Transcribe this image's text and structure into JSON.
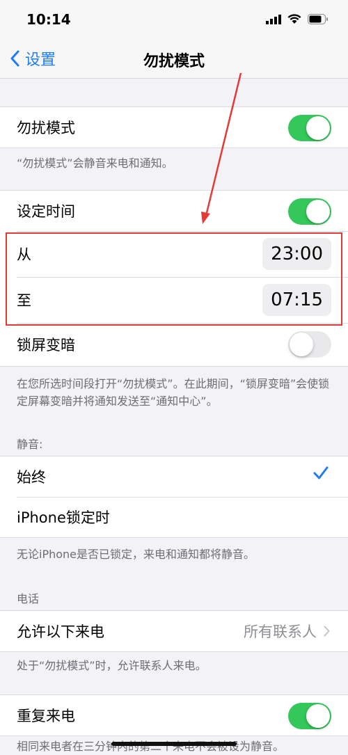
{
  "status_bar": {
    "time": "10:14"
  },
  "nav": {
    "back_label": "设置",
    "title": "勿扰模式"
  },
  "dnd": {
    "label": "勿扰模式",
    "enabled": true,
    "footer": "“勿扰模式”会静音来电和通知。"
  },
  "schedule": {
    "label": "设定时间",
    "enabled": true,
    "from_label": "从",
    "from_value": "23:00",
    "to_label": "至",
    "to_value": "07:15",
    "dim_label": "锁屏变暗",
    "dim_enabled": false,
    "footer": "在您所选时间段打开“勿扰模式”。在此期间，“锁屏变暗”会使锁定屏幕变暗并将通知发送至“通知中心”。"
  },
  "silence": {
    "header": "静音:",
    "options": [
      "始终",
      "iPhone锁定时"
    ],
    "selected": "始终",
    "footer": "无论iPhone是否已锁定，来电和通知都将静音。"
  },
  "phone": {
    "header": "电话",
    "allow_calls_label": "允许以下来电",
    "allow_calls_value": "所有联系人",
    "footer": "处于“勿扰模式”时，允许联系人来电。",
    "repeated_calls_label": "重复来电",
    "repeated_calls_enabled": true,
    "repeated_footer": "相同来电者在三分钟内的第二个来电不会被设为静音。"
  },
  "colors": {
    "accent": "#1f7cf5",
    "toggle_on": "#34c759",
    "annotation": "#e13a37"
  }
}
